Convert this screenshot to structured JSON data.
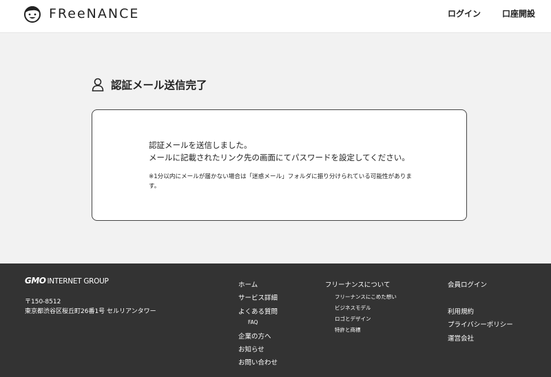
{
  "header": {
    "logo_text": "FReeNANCE",
    "nav": {
      "login": "ログイン",
      "open_account": "口座開設"
    }
  },
  "main": {
    "title": "認証メール送信完了",
    "message_line1": "認証メールを送信しました。",
    "message_line2": "メールに記載されたリンク先の画面にてパスワードを設定してください。",
    "note": "※1分以内にメールが届かない場合は「迷惑メール」フォルダに振り分けられている可能性があります。"
  },
  "footer": {
    "company_mark": "GMO",
    "company_rest": "INTERNET GROUP",
    "postal": "〒150-8512",
    "address": "東京都渋谷区桜丘町26番1号 セルリアンタワー",
    "col1": {
      "home": "ホーム",
      "services": "サービス詳細",
      "faq_head": "よくある質問",
      "faq": "FAQ",
      "corporate": "企業の方へ",
      "news": "お知らせ",
      "contact": "お問い合わせ"
    },
    "col2": {
      "about": "フリーナンスについて",
      "thoughts": "フリーナンスにこめた想い",
      "business_model": "ビジネスモデル",
      "logo_design": "ロゴとデザイン",
      "patents": "特許と商標"
    },
    "col3": {
      "member_login": "会員ログイン",
      "terms": "利用規約",
      "privacy": "プライバシーポリシー",
      "company": "運営会社"
    }
  },
  "colors": {
    "footer_bg": "#333333",
    "page_bg": "#f2f2f2",
    "card_border": "#444444"
  }
}
